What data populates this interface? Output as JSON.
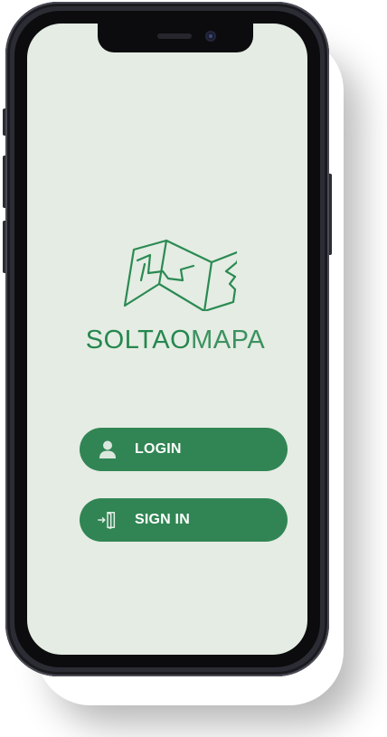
{
  "app": {
    "brand_primary": "SOLTAO",
    "brand_secondary": "MAPA"
  },
  "actions": {
    "login_label": "LOGIN",
    "signin_label": "SIGN IN"
  },
  "icons": {
    "logo": "folded-map-logo",
    "login": "user-icon",
    "signin": "door-enter-icon"
  },
  "colors": {
    "screen_background": "#e4ece3",
    "brand_green": "#2e8a54",
    "button_green": "#318554",
    "button_text": "#ffffff"
  }
}
